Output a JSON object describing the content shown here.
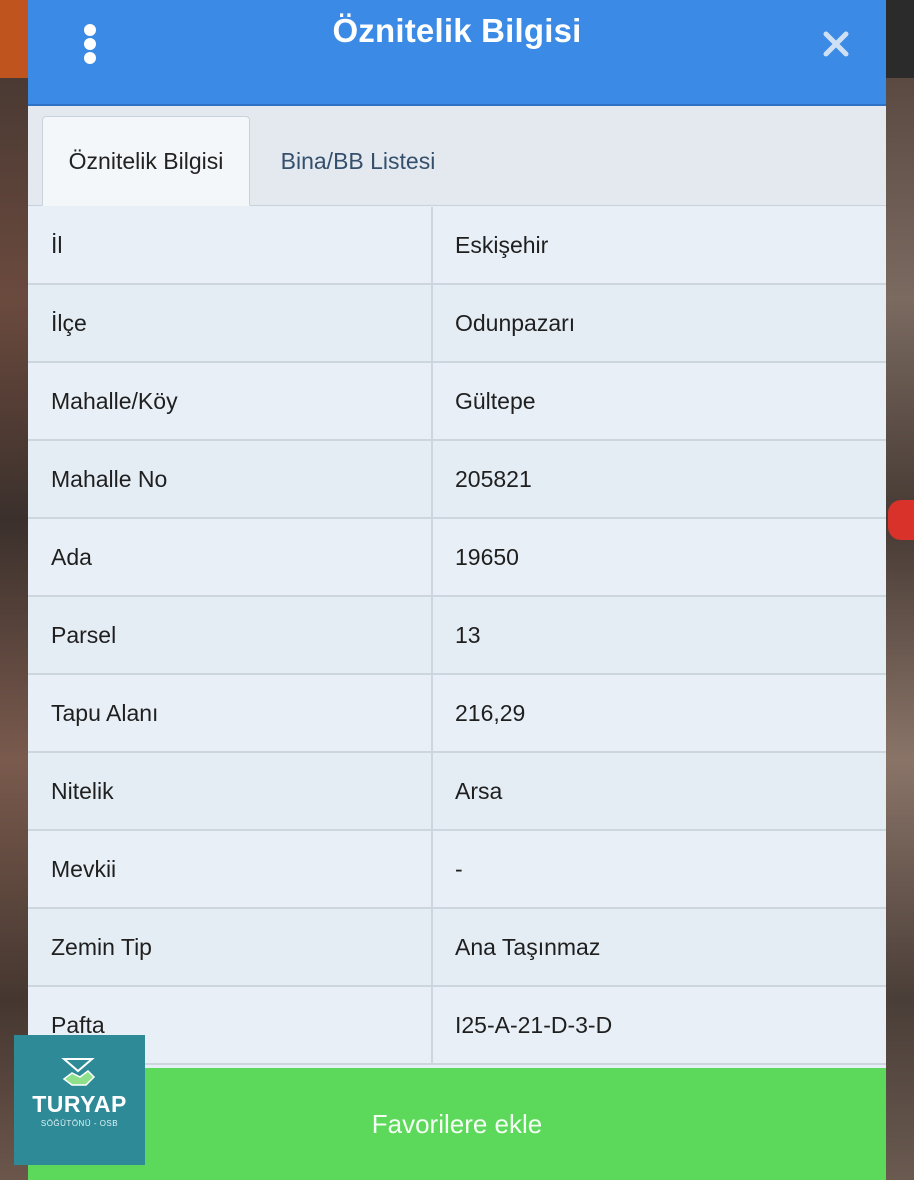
{
  "header": {
    "title": "Öznitelik Bilgisi"
  },
  "tabs": [
    {
      "label": "Öznitelik Bilgisi",
      "active": true
    },
    {
      "label": "Bina/BB Listesi",
      "active": false
    }
  ],
  "rows": [
    {
      "key": "İl",
      "value": "Eskişehir"
    },
    {
      "key": "İlçe",
      "value": "Odunpazarı"
    },
    {
      "key": "Mahalle/Köy",
      "value": "Gültepe"
    },
    {
      "key": "Mahalle No",
      "value": "205821"
    },
    {
      "key": "Ada",
      "value": "19650"
    },
    {
      "key": "Parsel",
      "value": "13"
    },
    {
      "key": "Tapu Alanı",
      "value": "216,29"
    },
    {
      "key": "Nitelik",
      "value": "Arsa"
    },
    {
      "key": "Mevkii",
      "value": "-"
    },
    {
      "key": "Zemin Tip",
      "value": "Ana Taşınmaz"
    },
    {
      "key": "Pafta",
      "value": "I25-A-21-D-3-D"
    }
  ],
  "footer": {
    "button_label": "Favorilere ekle"
  },
  "logo": {
    "name": "TURYAP",
    "sub": "SÖĞÜTÖNÜ - OSB"
  },
  "icons": {
    "menu": "kebab-menu-icon",
    "close": "close-icon"
  },
  "colors": {
    "header": "#3a8ae6",
    "footer_button": "#5cd85a",
    "panel": "#e6eef6"
  }
}
